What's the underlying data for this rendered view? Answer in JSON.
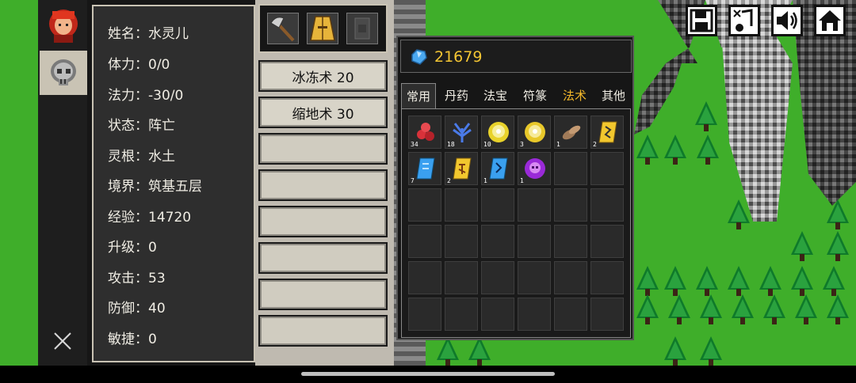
{
  "stats": {
    "name": "姓名：水灵儿",
    "hp": "体力：0/0",
    "mp": "法力：-30/0",
    "status": "状态：阵亡",
    "root": "灵根：水土",
    "realm": "境界：筑基五层",
    "exp": "经验：14720",
    "levelup": "升级：0",
    "attack": "攻击：53",
    "defense": "防御：40",
    "agility": "敏捷：0"
  },
  "skills": {
    "slot1": "冰冻术 20",
    "slot2": "缩地术 30"
  },
  "inventory": {
    "currency": "21679",
    "tabs": [
      "常用",
      "丹药",
      "法宝",
      "符篆",
      "法术",
      "其他"
    ],
    "items": [
      {
        "icon": "red-pills-icon",
        "count": "34"
      },
      {
        "icon": "blue-herb-icon",
        "count": "18"
      },
      {
        "icon": "yellow-orb-icon",
        "count": "10"
      },
      {
        "icon": "yellow-orb-icon",
        "count": "3"
      },
      {
        "icon": "bean-icon",
        "count": "1"
      },
      {
        "icon": "yellow-talisman-icon",
        "count": "2"
      },
      {
        "icon": "blue-talisman-icon",
        "count": "7"
      },
      {
        "icon": "yellow-scroll-icon",
        "count": "2"
      },
      {
        "icon": "blue-scroll-icon",
        "count": "1"
      },
      {
        "icon": "purple-skull-orb-icon",
        "count": "1"
      }
    ]
  },
  "colors": {
    "grass": "#3fae2a",
    "panel": "#2e2e2e",
    "accent": "#f3b82a",
    "gold": "#f3c533"
  }
}
